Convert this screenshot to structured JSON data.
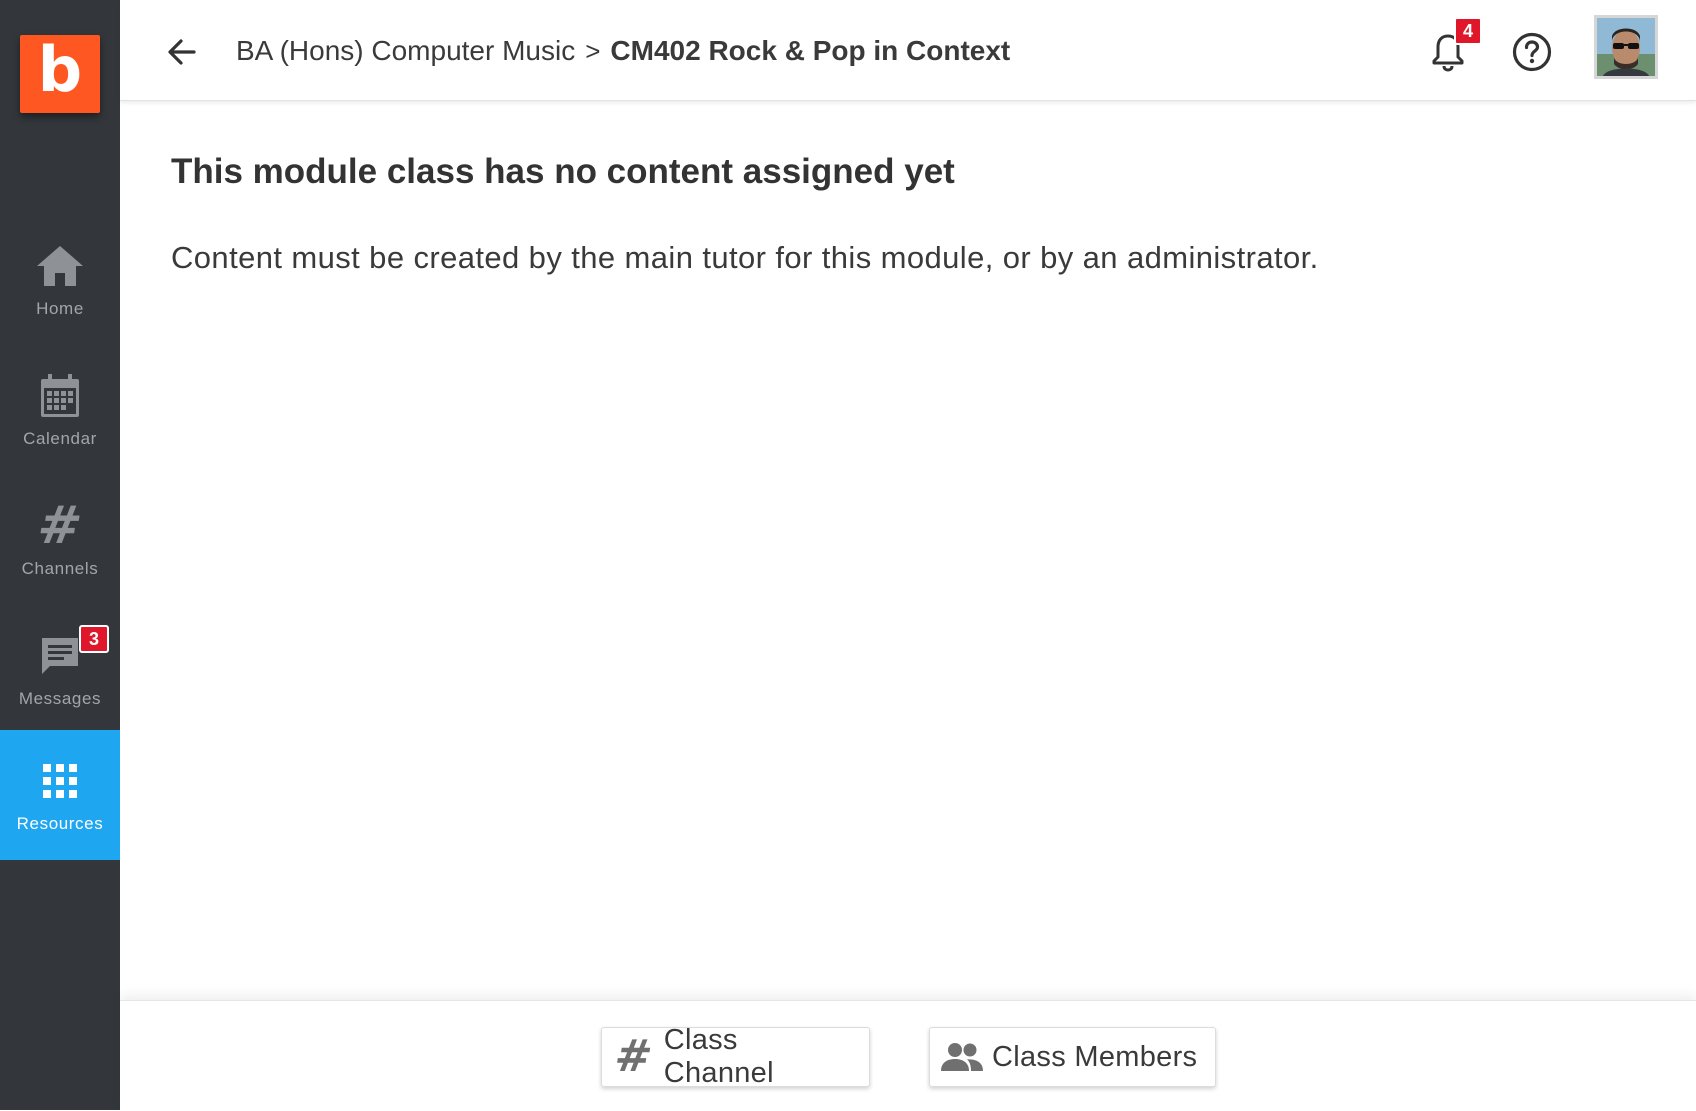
{
  "app": {
    "logo_letter": "b",
    "brand_color": "#ff5722",
    "accent_color": "#1fa6f0",
    "badge_color": "#e0162b"
  },
  "sidebar": {
    "items": [
      {
        "label": "Home",
        "icon": "home-icon",
        "active": false
      },
      {
        "label": "Calendar",
        "icon": "calendar-icon",
        "active": false
      },
      {
        "label": "Channels",
        "icon": "hash-icon",
        "active": false
      },
      {
        "label": "Messages",
        "icon": "message-icon",
        "active": false,
        "badge": "3"
      },
      {
        "label": "Resources",
        "icon": "grid-apps-icon",
        "active": true
      }
    ]
  },
  "header": {
    "back_icon": "arrow-back-icon",
    "breadcrumb_parent": "BA (Hons) Computer Music",
    "breadcrumb_separator": ">",
    "breadcrumb_current": "CM402 Rock & Pop in Context",
    "notifications_badge": "4",
    "bell_icon": "bell-icon",
    "help_icon": "help-circle-icon"
  },
  "main": {
    "title": "This module class has no content assigned yet",
    "message": "Content must be created by the main tutor for this module, or by an administrator."
  },
  "footer": {
    "class_channel_label": "Class Channel",
    "class_members_label": "Class Members"
  }
}
